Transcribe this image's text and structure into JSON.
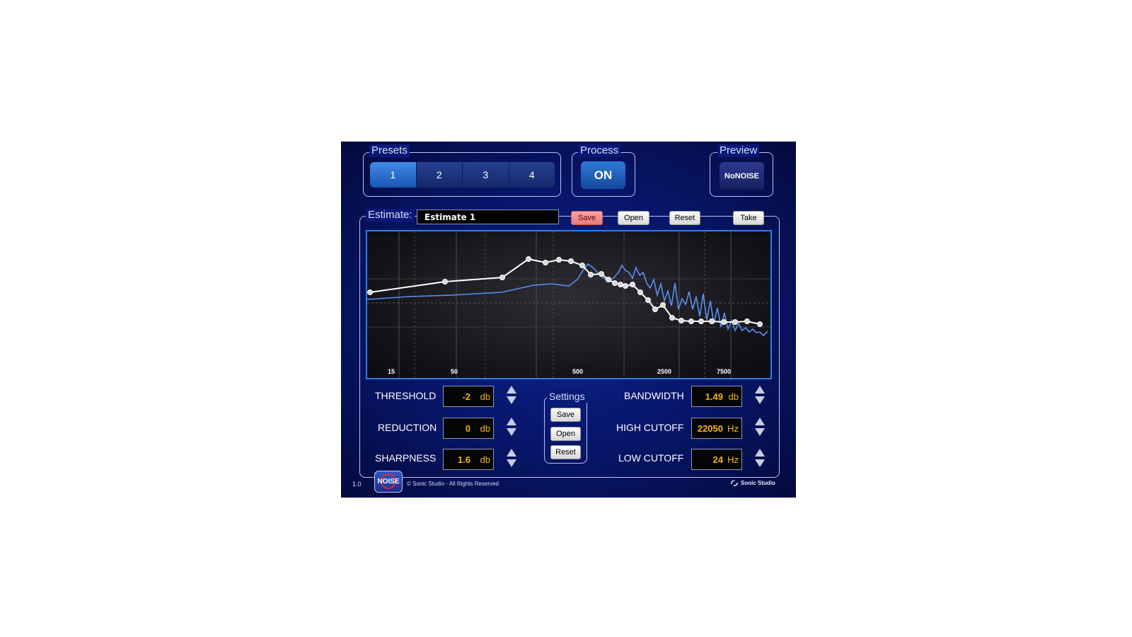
{
  "presets": {
    "label": "Presets",
    "items": [
      "1",
      "2",
      "3",
      "4"
    ],
    "active_index": 0
  },
  "process": {
    "label": "Process",
    "button": "ON"
  },
  "preview": {
    "label": "Preview",
    "button": "NoNOISE"
  },
  "estimate": {
    "label": "Estimate:",
    "name": "Estimate 1",
    "save": "Save",
    "open": "Open",
    "reset": "Reset",
    "take": "Take"
  },
  "graph": {
    "freq_labels": [
      "15",
      "50",
      "500",
      "2500",
      "7500"
    ],
    "colors": {
      "estimate_curve": "#ffffff",
      "spectrum": "#5c8ff2",
      "border": "#2f7de8"
    }
  },
  "params_left": [
    {
      "label": "THRESHOLD",
      "value": "-2",
      "unit": "db"
    },
    {
      "label": "REDUCTION",
      "value": "0",
      "unit": "db"
    },
    {
      "label": "SHARPNESS",
      "value": "1.6",
      "unit": "db"
    }
  ],
  "params_right": [
    {
      "label": "BANDWIDTH",
      "value": "1.49",
      "unit": "db"
    },
    {
      "label": "HIGH CUTOFF",
      "value": "22050",
      "unit": "Hz"
    },
    {
      "label": "LOW CUTOFF",
      "value": "24",
      "unit": "Hz"
    }
  ],
  "settings": {
    "label": "Settings",
    "save": "Save",
    "open": "Open",
    "reset": "Reset"
  },
  "footer": {
    "version": "1.0",
    "logo_text": "NOISE",
    "copyright": "© Sonic Studio - All Rights Reserved",
    "brand": "Sonic Studio"
  },
  "icons": {
    "stepper": "up-down-arrow-icon",
    "brand_logo": "sonic-studio-logo-icon",
    "noise_logo": "no-noise-logo-icon"
  }
}
